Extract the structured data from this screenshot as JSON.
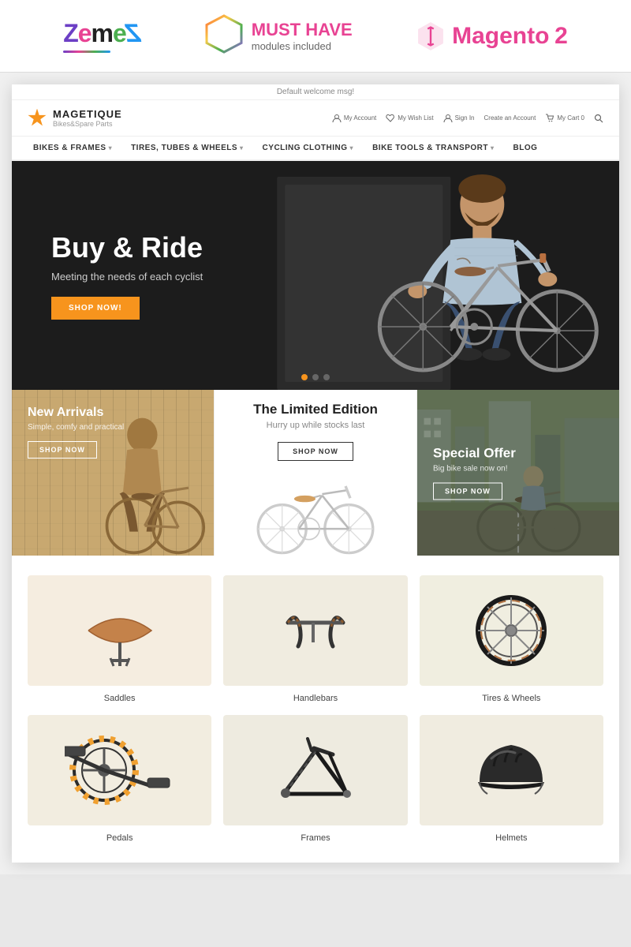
{
  "topBanner": {
    "zemesLogo": "ZemeZ",
    "mustHave": {
      "line1": "MUST HAVE",
      "line2": "modules included"
    },
    "magento": {
      "text": "Magento",
      "version": "2"
    }
  },
  "store": {
    "topbar": "Default welcome msg!",
    "logo": {
      "name": "MAGETIQUE",
      "sub": "Bikes&Spare Parts"
    },
    "navIcons": [
      {
        "label": "My Account",
        "icon": "user"
      },
      {
        "label": "My Wish List",
        "icon": "heart"
      },
      {
        "label": "Sign In",
        "icon": "user-sm"
      },
      {
        "label": "Create an Account",
        "icon": "user-add"
      },
      {
        "label": "My Cart 0",
        "icon": "cart"
      },
      {
        "label": "Search",
        "icon": "search"
      }
    ],
    "nav": [
      {
        "label": "BIKES & FRAMES",
        "hasDropdown": true
      },
      {
        "label": "TIRES, TUBES & WHEELS",
        "hasDropdown": true
      },
      {
        "label": "CYCLING CLOTHING",
        "hasDropdown": true
      },
      {
        "label": "BIKE TOOLS & TRANSPORT",
        "hasDropdown": true
      },
      {
        "label": "BLOG",
        "hasDropdown": false
      }
    ],
    "hero": {
      "title": "Buy & Ride",
      "subtitle": "Meeting the needs of each cyclist",
      "buttonLabel": "SHOP NOW!"
    },
    "promos": [
      {
        "title": "New Arrivals",
        "subtitle": "Simple, comfy and practical",
        "buttonLabel": "SHOP NOW"
      },
      {
        "title": "The Limited Edition",
        "subtitle": "Hurry up while stocks last",
        "buttonLabel": "SHOP NOW"
      },
      {
        "title": "Special Offer",
        "subtitle": "Big bike sale now on!",
        "buttonLabel": "SHOP NOW"
      }
    ],
    "categories": [
      {
        "name": "Saddles",
        "bg": "cat-bg-1"
      },
      {
        "name": "Handlebars",
        "bg": "cat-bg-2"
      },
      {
        "name": "Tires & Wheels",
        "bg": "cat-bg-3"
      },
      {
        "name": "Pedals",
        "bg": "cat-bg-4"
      },
      {
        "name": "Frames",
        "bg": "cat-bg-5"
      },
      {
        "name": "Helmets",
        "bg": "cat-bg-6"
      }
    ]
  }
}
